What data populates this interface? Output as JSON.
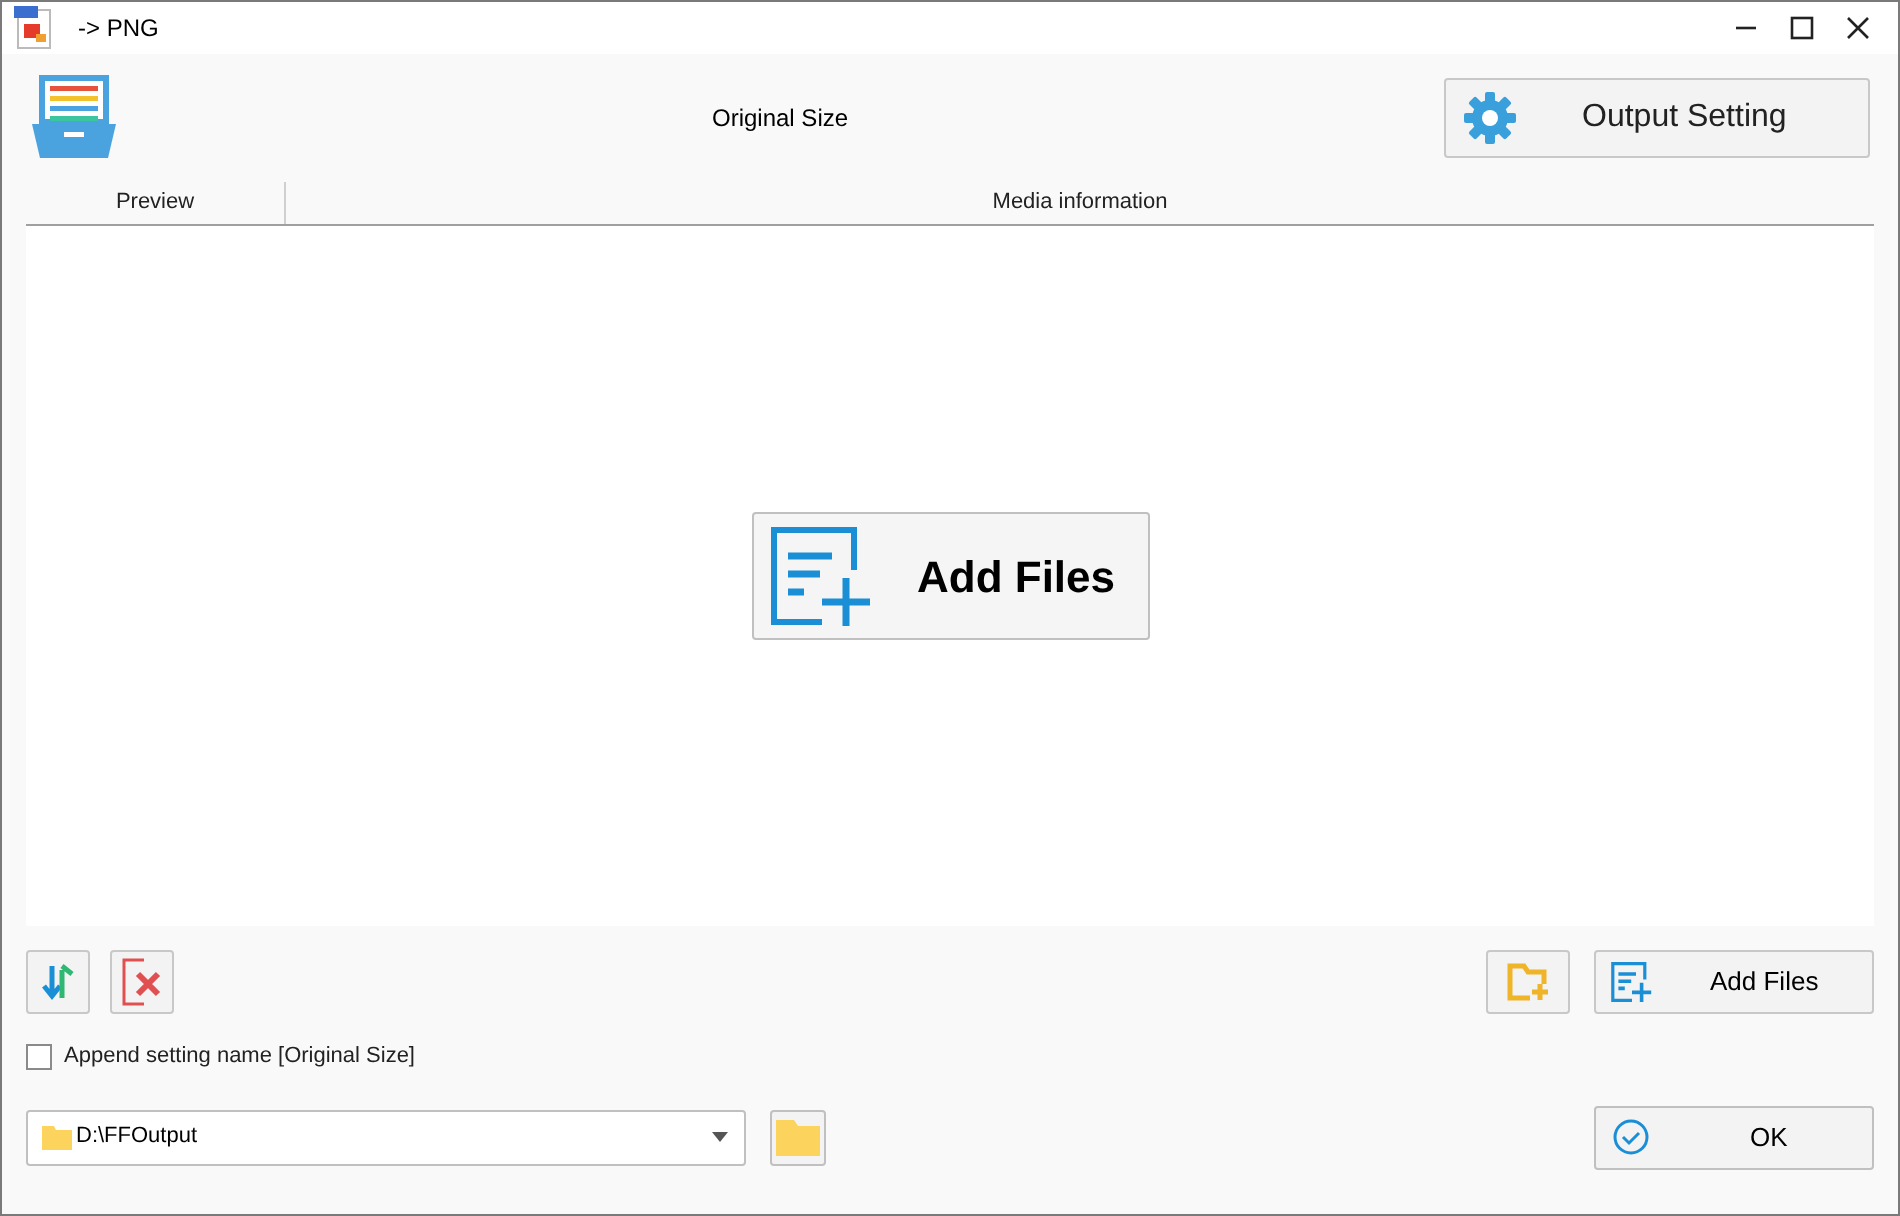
{
  "window": {
    "title": "-> PNG"
  },
  "header": {
    "setting_name": "Original Size",
    "output_setting_button": "Output Setting"
  },
  "table": {
    "columns": [
      "Preview",
      "Media information"
    ]
  },
  "add_files_center_button": "Add Files",
  "add_files_button": "Add Files",
  "append_setting_name": {
    "label": "Append setting name [Original Size]",
    "checked": false
  },
  "output_folder": {
    "value": "D:\\FFOutput"
  },
  "ok_button": "OK"
}
